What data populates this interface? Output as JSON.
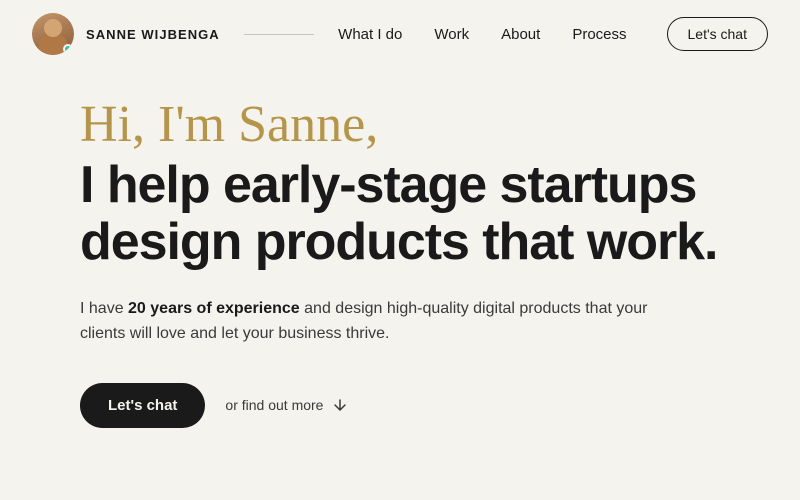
{
  "nav": {
    "name": "SANNE WIJBENGA",
    "links": [
      {
        "label": "What I do",
        "id": "what-i-do"
      },
      {
        "label": "Work",
        "id": "work"
      },
      {
        "label": "About",
        "id": "about"
      },
      {
        "label": "Process",
        "id": "process"
      }
    ],
    "cta_label": "Let's chat"
  },
  "hero": {
    "greeting": "Hi, I'm Sanne,",
    "headline_line1": "I help early-stage startups",
    "headline_line2": "design products that work.",
    "body_text_prefix": "I have ",
    "body_text_bold": "20 years of experience",
    "body_text_suffix": " and design high-quality digital products that your clients will love and let your business thrive.",
    "cta_label": "Let's chat",
    "secondary_label": "or find out more"
  },
  "colors": {
    "background": "#f5f3ee",
    "text_primary": "#1a1a1a",
    "text_secondary": "#3a3a3a",
    "accent_gold": "#b5954a",
    "accent_teal": "#2ec4a0",
    "btn_dark_bg": "#1a1a1a",
    "btn_dark_text": "#f5f3ee"
  }
}
